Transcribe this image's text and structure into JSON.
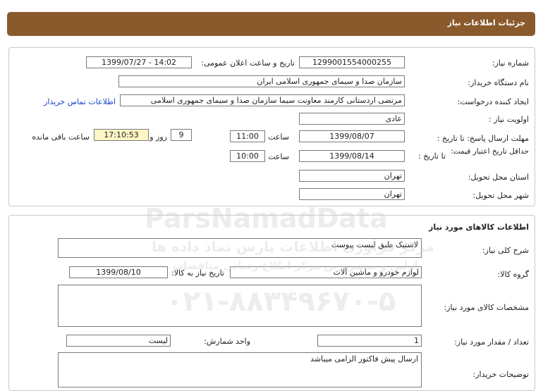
{
  "header": {
    "title": "جزئیات اطلاعات نیاز"
  },
  "details": {
    "need_number_label": "شماره نیاز:",
    "need_number": "1299001554000255",
    "announce_label": "تاریخ و ساعت اعلان عمومی:",
    "announce_value": "1399/07/27 - 14:02",
    "buyer_org_label": "نام دستگاه خریدار:",
    "buyer_org": "سازمان صدا و سیمای جمهوری اسلامی ایران",
    "requester_label": "ایجاد کننده درخواست:",
    "requester": "مرتضی اردستانی کارمند معاونت سیما سازمان صدا و سیمای جمهوری اسلامی",
    "contact_link": "اطلاعات تماس خریدار",
    "priority_label": "اولویت نیاز :",
    "priority": "عادی",
    "send_deadline_label": "مهلت ارسال پاسخ: تا تاریخ :",
    "send_date": "1399/08/07",
    "time_label": "ساعت",
    "send_time": "11:00",
    "days_value": "9",
    "days_label": "روز و",
    "remaining_time": "17:10:53",
    "remaining_label": "ساعت باقی مانده",
    "min_validity_label": "حداقل تاریخ اعتبار قیمت:",
    "to_date_label": "تا تاریخ :",
    "validity_date": "1399/08/14",
    "validity_time": "10:00",
    "province_label": "استان محل تحویل:",
    "province": "تهران",
    "city_label": "شهر محل تحویل:",
    "city": "تهران"
  },
  "goods": {
    "section_title": "اطلاعات کالاهای مورد نیاز",
    "summary_label": "شرح کلی نیاز:",
    "summary": "لاستیک طبق لیست پیوست",
    "group_label": "گروه کالا:",
    "group": "لوازم خودرو و ماشین آلات",
    "need_date_label": "تاریخ نیاز به کالا:",
    "need_date": "1399/08/10",
    "specs_label": "مشخصات کالای مورد نیاز:",
    "specs": "",
    "qty_label": "تعداد / مقدار مورد نیاز:",
    "qty": "1",
    "unit_label": "واحد شمارش:",
    "unit": "لیست",
    "buyer_notes_label": "توضیحات خریدار:",
    "buyer_notes": "ارسال پیش فاکتور الزامی میباشد"
  },
  "watermark": {
    "brand": "ParsNamadData",
    "persian": "مرکز فرآوری اطلاعات پارس نماد داده ها",
    "persian2": "اولین و معتبرترین مرکز اطلاع رسانی مناقصات",
    "phone": "۰۲۱-۸۸۳۴۹۶۷۰-۵"
  }
}
